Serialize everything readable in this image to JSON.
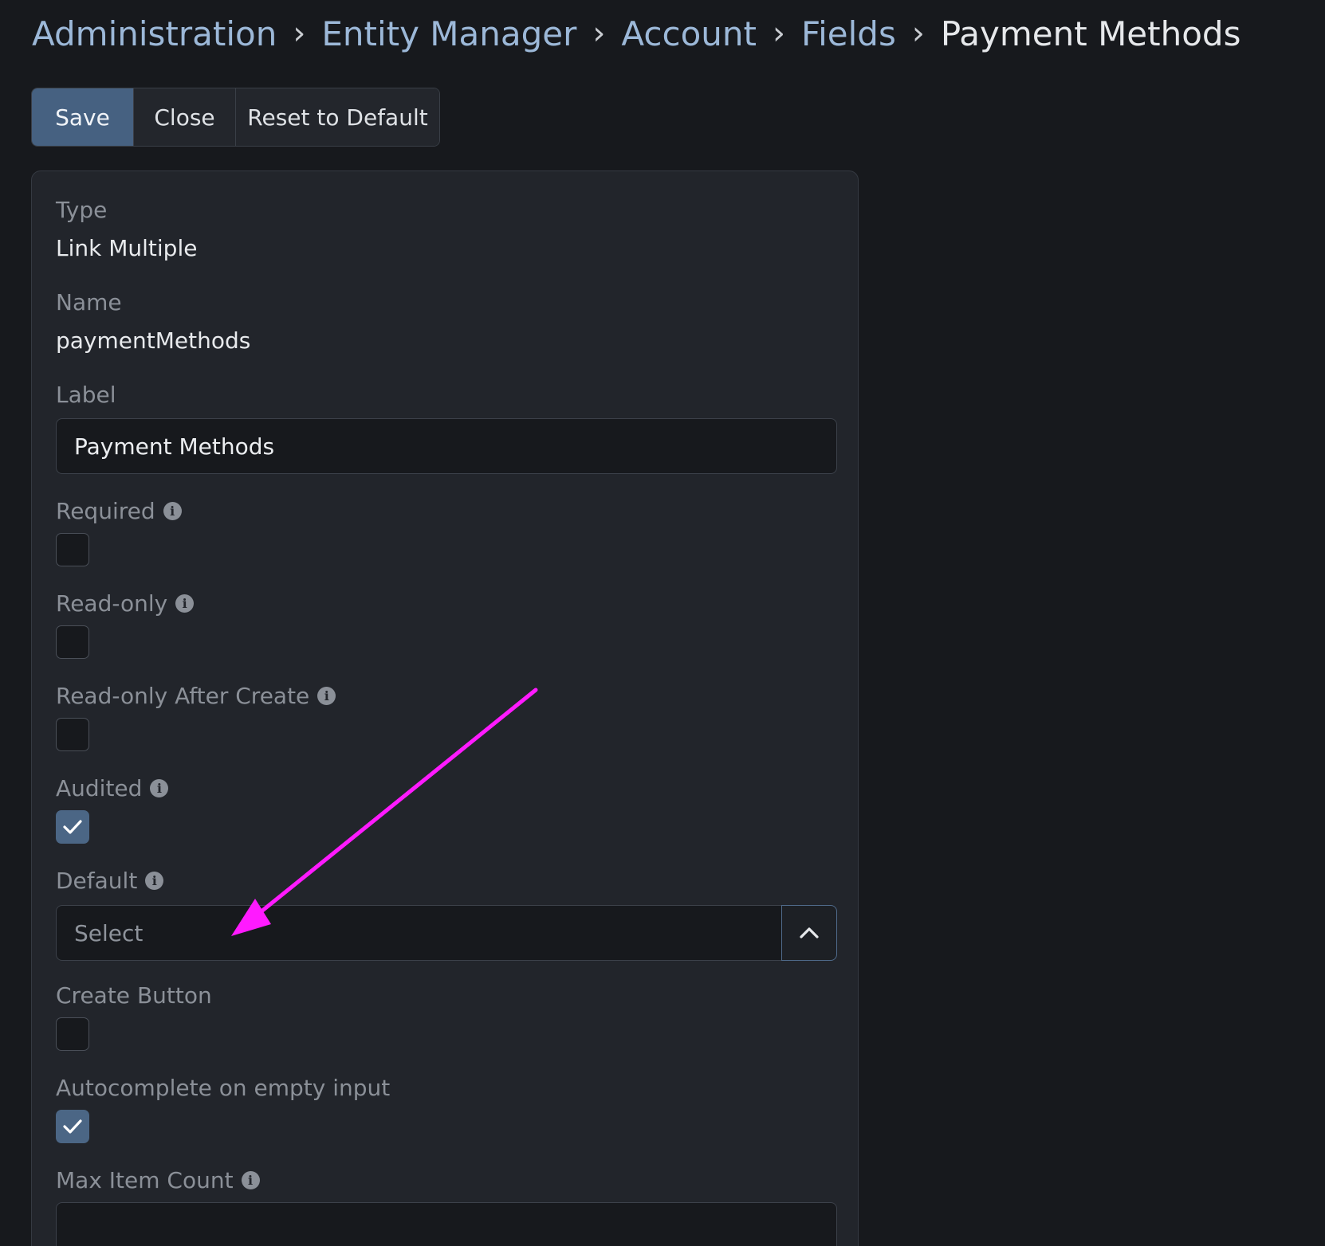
{
  "breadcrumb": {
    "items": [
      "Administration",
      "Entity Manager",
      "Account",
      "Fields"
    ],
    "current": "Payment Methods",
    "separator": "›"
  },
  "toolbar": {
    "save_label": "Save",
    "close_label": "Close",
    "reset_label": "Reset to Default"
  },
  "fields": {
    "type": {
      "label": "Type",
      "value": "Link Multiple"
    },
    "name": {
      "label": "Name",
      "value": "paymentMethods"
    },
    "label": {
      "label": "Label",
      "value": "Payment Methods"
    },
    "required": {
      "label": "Required",
      "checked": false
    },
    "read_only": {
      "label": "Read-only",
      "checked": false
    },
    "read_only_after_create": {
      "label": "Read-only After Create",
      "checked": false
    },
    "audited": {
      "label": "Audited",
      "checked": true
    },
    "default": {
      "label": "Default",
      "placeholder": "Select"
    },
    "create_button": {
      "label": "Create Button",
      "checked": false
    },
    "autocomplete": {
      "label": "Autocomplete on empty input",
      "checked": true
    },
    "max_item_count": {
      "label": "Max Item Count",
      "value": ""
    }
  },
  "icons": {
    "info": "info-icon",
    "check": "check-icon",
    "chevron": "chevron-up-icon"
  },
  "colors": {
    "link": "#9cb8d8",
    "primary": "#466181",
    "annotation_arrow": "#ff1aff"
  }
}
